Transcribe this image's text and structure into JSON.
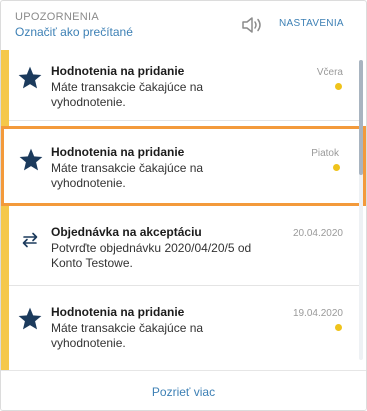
{
  "header": {
    "title": "UPOZORNENIA",
    "mark_read": "Označiť ako prečítané",
    "sound_icon": "speaker-icon",
    "settings": "NASTAVENIA"
  },
  "notifications": [
    {
      "icon": "star-icon",
      "title": "Hodnotenia na pridanie",
      "description": "Máte transakcie čakajúce na vyhodnotenie.",
      "date": "Včera",
      "unread": true,
      "selected": false
    },
    {
      "icon": "star-icon",
      "title": "Hodnotenia na pridanie",
      "description": "Máte transakcie čakajúce na vyhodnotenie.",
      "date": "Piatok",
      "unread": true,
      "selected": true
    },
    {
      "icon": "exchange-arrows-icon",
      "title": "Objednávka na akceptáciu",
      "description": "Potvrďte objednávku 2020/04/20/5 od Konto Testowe.",
      "date": "20.04.2020",
      "unread": false,
      "selected": false
    },
    {
      "icon": "star-icon",
      "title": "Hodnotenia na pridanie",
      "description": "Máte transakcie čakajúce na vyhodnotenie.",
      "date": "19.04.2020",
      "unread": true,
      "selected": false
    }
  ],
  "footer": {
    "see_more": "Pozrieť viac"
  },
  "colors": {
    "accent_yellow": "#f5c84a",
    "link_blue": "#3d80b5",
    "selection_orange": "#f39a3b",
    "unread_dot": "#efc31b",
    "star_navy": "#1b3a5c"
  }
}
